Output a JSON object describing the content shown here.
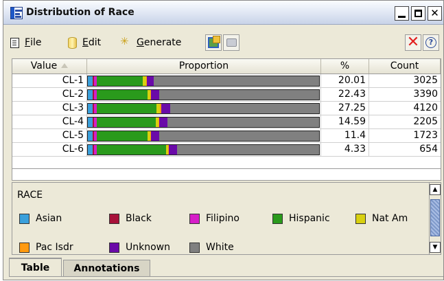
{
  "window": {
    "title": "Distribution of Race"
  },
  "menu": {
    "file": {
      "underline": "F",
      "rest": "ile"
    },
    "edit": {
      "underline": "E",
      "rest": "dit"
    },
    "generate": {
      "underline": "G",
      "rest": "enerate"
    }
  },
  "table": {
    "columns": [
      "Value",
      "Proportion",
      "%",
      "Count"
    ],
    "sort_column": "Value",
    "rows": [
      {
        "value": "CL-1",
        "pct": "20.01",
        "count": "3025",
        "mix": {
          "asian": 0.022,
          "black": 0.004,
          "filipino": 0.012,
          "hispanic": 0.2,
          "natam": 0.014,
          "pacisdr": 0.004,
          "unknown": 0.03,
          "white": 0.714
        }
      },
      {
        "value": "CL-2",
        "pct": "22.43",
        "count": "3390",
        "mix": {
          "asian": 0.022,
          "black": 0.004,
          "filipino": 0.012,
          "hispanic": 0.22,
          "natam": 0.012,
          "pacisdr": 0.004,
          "unknown": 0.035,
          "white": 0.691
        }
      },
      {
        "value": "CL-3",
        "pct": "27.25",
        "count": "4120",
        "mix": {
          "asian": 0.022,
          "black": 0.004,
          "filipino": 0.012,
          "hispanic": 0.26,
          "natam": 0.015,
          "pacisdr": 0.004,
          "unknown": 0.04,
          "white": 0.643
        }
      },
      {
        "value": "CL-4",
        "pct": "14.59",
        "count": "2205",
        "mix": {
          "asian": 0.022,
          "black": 0.004,
          "filipino": 0.012,
          "hispanic": 0.255,
          "natam": 0.012,
          "pacisdr": 0.004,
          "unknown": 0.035,
          "white": 0.656
        }
      },
      {
        "value": "CL-5",
        "pct": "11.4",
        "count": "1723",
        "mix": {
          "asian": 0.022,
          "black": 0.004,
          "filipino": 0.012,
          "hispanic": 0.22,
          "natam": 0.012,
          "pacisdr": 0.004,
          "unknown": 0.035,
          "white": 0.691
        }
      },
      {
        "value": "CL-6",
        "pct": "4.33",
        "count": "654",
        "mix": {
          "asian": 0.022,
          "black": 0.004,
          "filipino": 0.012,
          "hispanic": 0.3,
          "natam": 0.008,
          "pacisdr": 0.004,
          "unknown": 0.035,
          "white": 0.615
        }
      }
    ]
  },
  "legend": {
    "title": "RACE",
    "items": [
      {
        "key": "asian",
        "label": "Asian",
        "color": "#3aa0dc"
      },
      {
        "key": "black",
        "label": "Black",
        "color": "#a8123a"
      },
      {
        "key": "filipino",
        "label": "Filipino",
        "color": "#d61ec8"
      },
      {
        "key": "hispanic",
        "label": "Hispanic",
        "color": "#2a9a1c"
      },
      {
        "key": "natam",
        "label": "Nat Am",
        "color": "#d8d010"
      },
      {
        "key": "pacisdr",
        "label": "Pac Isdr",
        "color": "#ff9a10"
      },
      {
        "key": "unknown",
        "label": "Unknown",
        "color": "#6a0aa8"
      },
      {
        "key": "white",
        "label": "White",
        "color": "#808080"
      }
    ]
  },
  "tabs": {
    "table": "Table",
    "annotations": "Annotations"
  }
}
